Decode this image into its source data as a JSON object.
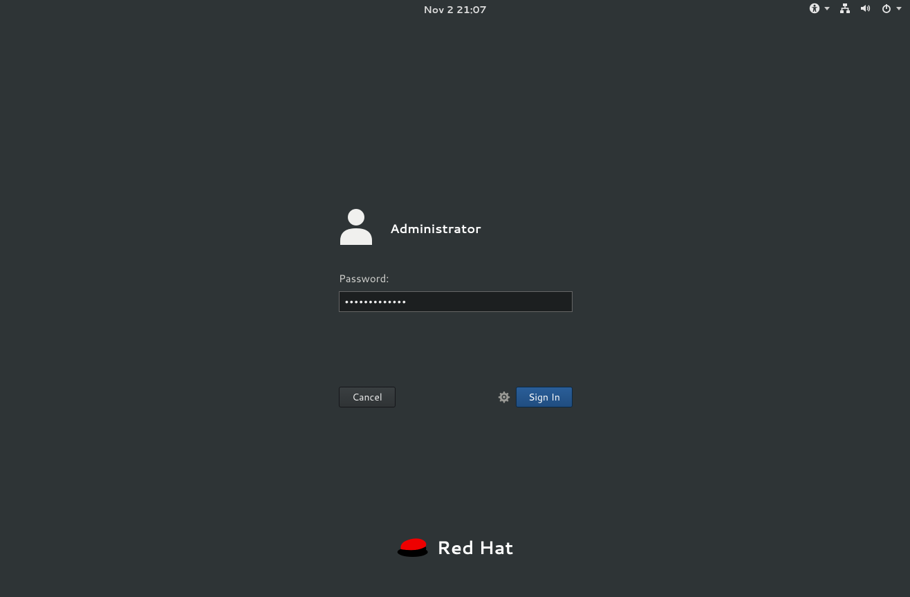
{
  "topbar": {
    "datetime": "Nov 2  21:07"
  },
  "login": {
    "username": "Administrator",
    "password_label": "Password:",
    "password_value": "●●●●●●●●●●●●●",
    "cancel_label": "Cancel",
    "signin_label": "Sign In"
  },
  "brand": {
    "name": "Red Hat"
  },
  "icons": {
    "accessibility": "accessibility-icon",
    "network": "network-wired-icon",
    "volume": "volume-icon",
    "power": "power-icon",
    "session_gear": "gear-icon",
    "user_avatar": "user-avatar-icon",
    "fedora_hat": "redhat-fedora-icon"
  },
  "colors": {
    "background": "#2e3436",
    "accent_blue": "#2a5e98",
    "brand_red": "#e00"
  }
}
